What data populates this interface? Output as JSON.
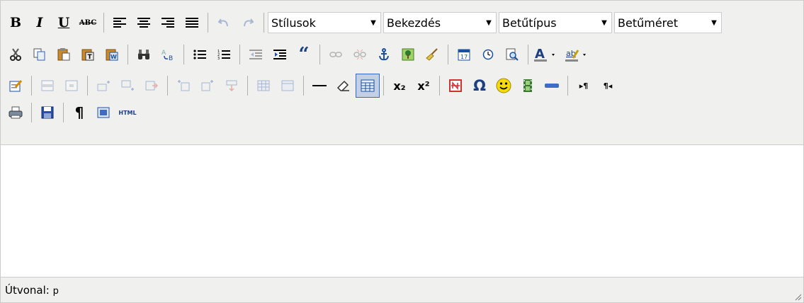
{
  "toolbar": {
    "bold_label": "B",
    "italic_label": "I",
    "underline_label": "U",
    "strike_label": "ABC",
    "blockquote_label": "“",
    "subscript_label": "x₂",
    "superscript_label": "x²",
    "omega_label": "Ω",
    "pilcrow_label": "¶",
    "html_label": "HTML",
    "styles_select": "Stílusok",
    "paragraph_select": "Bekezdés",
    "font_select": "Betűtípus",
    "size_select": "Betűméret",
    "ltr_label": "▸¶",
    "rtl_label": "¶◂"
  },
  "statusbar": {
    "path_label": "Útvonal:",
    "path_value": "p"
  },
  "colors": {
    "toolbar_bg": "#f0f0ee",
    "border": "#cccccc",
    "active_border": "#316ac5",
    "active_bg": "#c2cfe5"
  }
}
